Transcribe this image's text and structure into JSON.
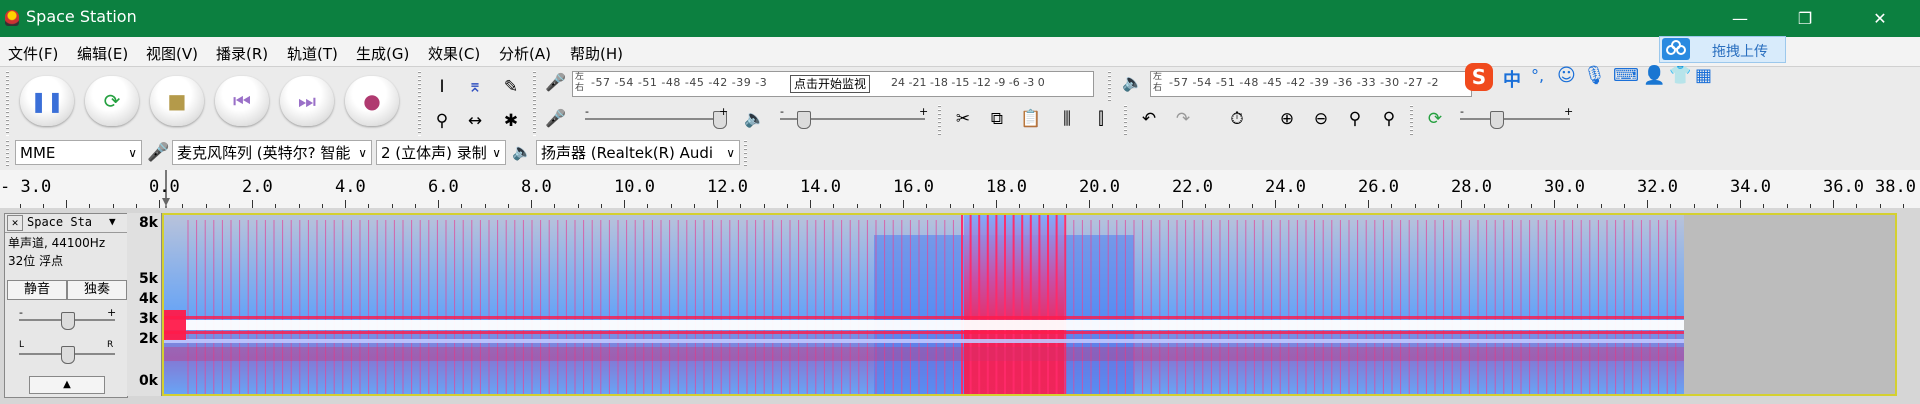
{
  "window": {
    "title": "Space Station",
    "minimize": "—",
    "maximize": "❐",
    "close": "✕"
  },
  "menus": [
    "文件(F)",
    "编辑(E)",
    "视图(V)",
    "播录(R)",
    "轨道(T)",
    "生成(G)",
    "效果(C)",
    "分析(A)",
    "帮助(H)"
  ],
  "transport": {
    "pause": "pause-icon",
    "loop": "loop-icon",
    "stop": "stop-icon",
    "skip_start": "skip-start-icon",
    "skip_end": "skip-end-icon",
    "record": "record-icon"
  },
  "meters": {
    "record_lr": [
      "左",
      "右"
    ],
    "record_ticks": "-57 -54 -51 -48 -45 -42 -39 -3",
    "record_ticks_after": "24 -21 -18 -15 -12  -9  -6  -3  0",
    "monitor_tooltip": "点击开始监视",
    "playback_lr": [
      "左",
      "右"
    ],
    "playback_ticks": "-57 -54 -51 -48 -45 -42 -39 -36 -33 -30 -27 -2"
  },
  "sliders": {
    "minus": "-",
    "plus": "+"
  },
  "devices": {
    "host": "MME",
    "recording_device": "麦克风阵列 (英特尔? 智能",
    "channels": "2 (立体声) 录制",
    "playback_device": "扬声器 (Realtek(R) Audi"
  },
  "ruler": {
    "labels": [
      "- 3.0",
      "0.0",
      "2.0",
      "4.0",
      "6.0",
      "8.0",
      "10.0",
      "12.0",
      "14.0",
      "16.0",
      "18.0",
      "20.0",
      "22.0",
      "24.0",
      "26.0",
      "28.0",
      "30.0",
      "32.0",
      "34.0",
      "36.0",
      "38.0"
    ],
    "end_label": "38.0"
  },
  "track": {
    "name": "Space Sta",
    "info1": "单声道, 44100Hz",
    "info2": "32位 浮点",
    "mute": "静音",
    "solo": "独奏",
    "close": "✕",
    "menu_arrow": "▼",
    "collapse": "▲",
    "gain_minus": "-",
    "gain_plus": "+",
    "pan_left": "L",
    "pan_right": "R"
  },
  "vscale": [
    "8k",
    "5k",
    "4k",
    "3k",
    "2k",
    "0k"
  ],
  "ime": {
    "input_mode": "中",
    "punct": "°,"
  },
  "upload": {
    "label": "拖拽上传"
  },
  "colors": {
    "titlebar": "#0c8040",
    "spectro_hot": "#ff1a4a",
    "spectro_cool": "#5aa0ff",
    "selection_border": "#d4d030"
  }
}
